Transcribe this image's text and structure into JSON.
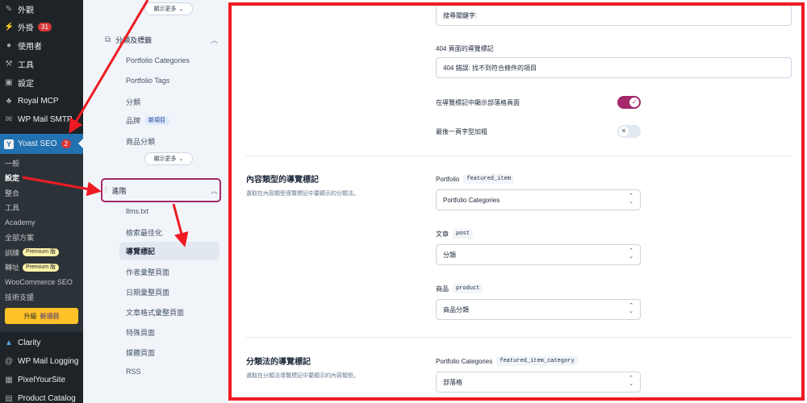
{
  "wp_menu": {
    "top_items": [
      {
        "icon": "brush-icon",
        "label": "外觀"
      },
      {
        "icon": "plugin-icon",
        "label": "外掛",
        "badge": "31"
      },
      {
        "icon": "users-icon",
        "label": "使用者"
      },
      {
        "icon": "wrench-icon",
        "label": "工具"
      },
      {
        "icon": "settings-icon",
        "label": "設定"
      },
      {
        "icon": "sitemap-icon",
        "label": "Royal MCP"
      },
      {
        "icon": "mail-icon",
        "label": "WP Mail SMTP"
      }
    ],
    "yoast": {
      "label": "Yoast SEO",
      "badge": "2"
    },
    "yoast_submenu": [
      "一般",
      "設定",
      "整合",
      "工具",
      "Academy",
      "全部方案",
      "訓練",
      "轉址",
      "WooCommerce SEO",
      "技術支援"
    ],
    "premium_label": "Premium 版",
    "upgrade": {
      "label": "升級",
      "badge": "新項目"
    },
    "bottom_items": [
      {
        "icon": "clarity-icon",
        "label": "Clarity"
      },
      {
        "icon": "at-icon",
        "label": "WP Mail Logging"
      },
      {
        "icon": "pixel-icon",
        "label": "PixelYourSite"
      },
      {
        "icon": "catalog-icon",
        "label": "Product Catalog"
      }
    ]
  },
  "settings_nav": {
    "show_more": "顯示更多",
    "taxonomies_group": "分類及標籤",
    "taxonomy_links": [
      "Portfolio Categories",
      "Portfolio Tags",
      "分類",
      "品牌",
      "商品分類"
    ],
    "new_badge": "新項目",
    "advanced_group": "進階",
    "advanced_links": [
      "llms.txt",
      "檢索最佳化",
      "導覽標記",
      "作者彙整頁面",
      "日期彙整頁面",
      "文章格式彙整頁面",
      "特殊頁面",
      "媒體頁面",
      "RSS"
    ]
  },
  "main": {
    "search_prefix_value": "搜尋關鍵字:",
    "breadcrumb_404_label": "404 頁面的導覽標記",
    "breadcrumb_404_value": "404 錯誤: 找不到符合條件的項目",
    "toggle_blog_label": "在導覽標記中顯示部落格頁面",
    "toggle_blog_on": true,
    "toggle_bold_label": "最後一頁字型加粗",
    "toggle_bold_on": false,
    "content_types": {
      "title": "內容類型的導覽標記",
      "desc": "選取在內容類型導覽標記中要顯示的分類法。",
      "rows": [
        {
          "label": "Portfolio",
          "tag": "featured_item",
          "value": "Portfolio Categories"
        },
        {
          "label": "文章",
          "tag": "post",
          "value": "分類"
        },
        {
          "label": "商品",
          "tag": "product",
          "value": "商品分類"
        }
      ]
    },
    "taxonomies": {
      "title": "分類法的導覽標記",
      "desc": "選取在分類法導覽標記中要顯示的內容類型。",
      "rows": [
        {
          "label": "Portfolio Categories",
          "tag": "featured_item_category",
          "value": "部落格"
        }
      ]
    }
  },
  "colors": {
    "wp_sidebar": "#1d2327",
    "wp_active": "#2271b1",
    "yoast_primary": "#a4286a",
    "annotation_red": "#ee1b22",
    "upgrade_yellow": "#fec228"
  }
}
